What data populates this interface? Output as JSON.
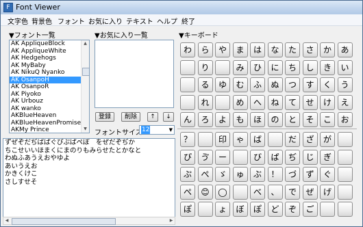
{
  "window": {
    "title": "Font Viewer"
  },
  "menu": [
    "文字色",
    "背景色",
    "フォント",
    "お気に入り",
    "テキスト",
    "ヘルプ",
    "終了"
  ],
  "sections": {
    "font_list": "▼フォント一覧",
    "favorites": "▼お気に入り一覧",
    "keyboard": "▼キーボード"
  },
  "font_list": {
    "items": [
      "AK AppliqueBlock",
      "AK AppliqueWhite",
      "AK Hedgehogs",
      "AK MyBaby",
      "AK NikuQ Nyanko",
      "AK OsanpoH",
      "AK OsanpoR",
      "AK Piyoko",
      "AK Urbouz",
      "AK wanko",
      "AKBlueHeaven",
      "AKBlueHeavenPromised",
      "AKMy Prince"
    ],
    "selected_index": 5
  },
  "favorites": {
    "items": []
  },
  "buttons": {
    "register": "登録",
    "delete": "削除",
    "up": "↑",
    "down": "↓"
  },
  "font_size": {
    "label": "フォントサイズ",
    "value": "12"
  },
  "text_area": {
    "lines": [
      "ずぜぞだぢばぱぐぴぷぱぺぽ　をぜだぞぢか",
      "ちこせいいほまくにまのりもみらせたとかなと",
      "わぬふあうえおやゆよ",
      "あいうえお",
      "かきくけこ",
      "さしすせそ"
    ]
  },
  "keyboard": {
    "top": [
      [
        "わ",
        "ら",
        "や",
        "ま",
        "は",
        "な",
        "た",
        "さ",
        "か",
        "あ"
      ],
      [
        "",
        "り",
        "",
        "み",
        "ひ",
        "に",
        "ち",
        "し",
        "き",
        "い"
      ],
      [
        "",
        "る",
        "ゆ",
        "む",
        "ふ",
        "ぬ",
        "つ",
        "す",
        "く",
        "う"
      ],
      [
        "",
        "れ",
        "",
        "め",
        "へ",
        "ね",
        "て",
        "せ",
        "け",
        "え"
      ],
      [
        "ん",
        "ろ",
        "よ",
        "も",
        "ほ",
        "の",
        "と",
        "そ",
        "こ",
        "お"
      ]
    ],
    "bottom": [
      [
        "？",
        "",
        "印",
        "ゃ",
        "ば",
        "",
        "だ",
        "ざ",
        "が",
        ""
      ],
      [
        "ぴ",
        "ゔ",
        "ー",
        "",
        "び",
        "ぱ",
        "ぢ",
        "じ",
        "ぎ",
        ""
      ],
      [
        "ぷ",
        "ぺ",
        "ゞ",
        "ゅ",
        "ぶ",
        "！",
        "づ",
        "ず",
        "ぐ",
        ""
      ],
      [
        "ぺ",
        "😊",
        "◯",
        "",
        "べ",
        "、",
        "で",
        "ぜ",
        "げ",
        ""
      ],
      [
        "ぽ",
        "",
        "ょ",
        "ぼ",
        "ぽ",
        "ど",
        "ぞ",
        "ご",
        "",
        ""
      ]
    ]
  }
}
